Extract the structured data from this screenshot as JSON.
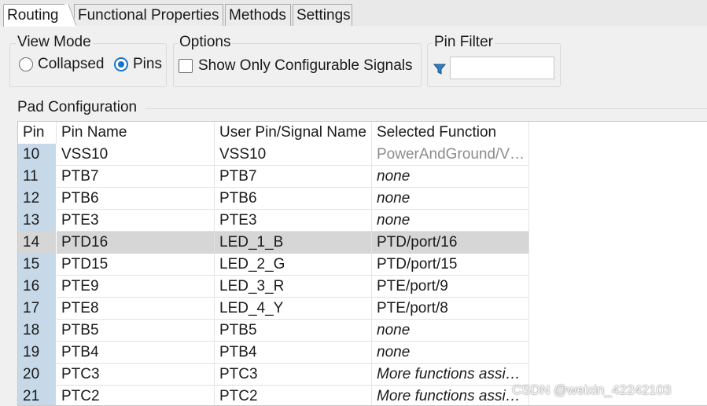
{
  "tabs": [
    {
      "label": "Routing",
      "active": true
    },
    {
      "label": "Functional Properties",
      "active": false
    },
    {
      "label": "Methods",
      "active": false
    },
    {
      "label": "Settings",
      "active": false
    }
  ],
  "view_mode": {
    "title": "View Mode",
    "options": [
      {
        "label": "Collapsed",
        "checked": false
      },
      {
        "label": "Pins",
        "checked": true
      }
    ]
  },
  "options": {
    "title": "Options",
    "show_configurable_label": "Show Only Configurable Signals",
    "show_configurable_checked": false
  },
  "pin_filter": {
    "title": "Pin Filter",
    "value": ""
  },
  "pad_config": {
    "title": "Pad Configuration",
    "columns": [
      "Pin",
      "Pin Name",
      "User Pin/Signal Name",
      "Selected Function"
    ],
    "rows": [
      {
        "pin": "10",
        "pin_name": "VSS10",
        "user_name": "VSS10",
        "function": "PowerAndGround/V…",
        "style": "muted"
      },
      {
        "pin": "11",
        "pin_name": "PTB7",
        "user_name": "PTB7",
        "function": "none",
        "style": "italic"
      },
      {
        "pin": "12",
        "pin_name": "PTB6",
        "user_name": "PTB6",
        "function": "none",
        "style": "italic"
      },
      {
        "pin": "13",
        "pin_name": "PTE3",
        "user_name": "PTE3",
        "function": "none",
        "style": "italic"
      },
      {
        "pin": "14",
        "pin_name": "PTD16",
        "user_name": "LED_1_B",
        "function": "PTD/port/16",
        "style": "normal",
        "selected": true
      },
      {
        "pin": "15",
        "pin_name": "PTD15",
        "user_name": "LED_2_G",
        "function": "PTD/port/15",
        "style": "normal"
      },
      {
        "pin": "16",
        "pin_name": "PTE9",
        "user_name": "LED_3_R",
        "function": "PTE/port/9",
        "style": "normal"
      },
      {
        "pin": "17",
        "pin_name": "PTE8",
        "user_name": "LED_4_Y",
        "function": "PTE/port/8",
        "style": "normal"
      },
      {
        "pin": "18",
        "pin_name": "PTB5",
        "user_name": "PTB5",
        "function": "none",
        "style": "italic"
      },
      {
        "pin": "19",
        "pin_name": "PTB4",
        "user_name": "PTB4",
        "function": "none",
        "style": "italic"
      },
      {
        "pin": "20",
        "pin_name": "PTC3",
        "user_name": "PTC3",
        "function": "More functions assi…",
        "style": "italic"
      },
      {
        "pin": "21",
        "pin_name": "PTC2",
        "user_name": "PTC2",
        "function": "More functions assi…",
        "style": "italic"
      }
    ]
  },
  "watermark": "CSDN @weixin_42242103",
  "colors": {
    "accent": "#1a73c8",
    "pin_cell_bg": "#c7d9e8",
    "selected_row_bg": "#d6d6d6",
    "muted_text": "#8c8c8c"
  },
  "icons": {
    "filter": "funnel-icon"
  }
}
